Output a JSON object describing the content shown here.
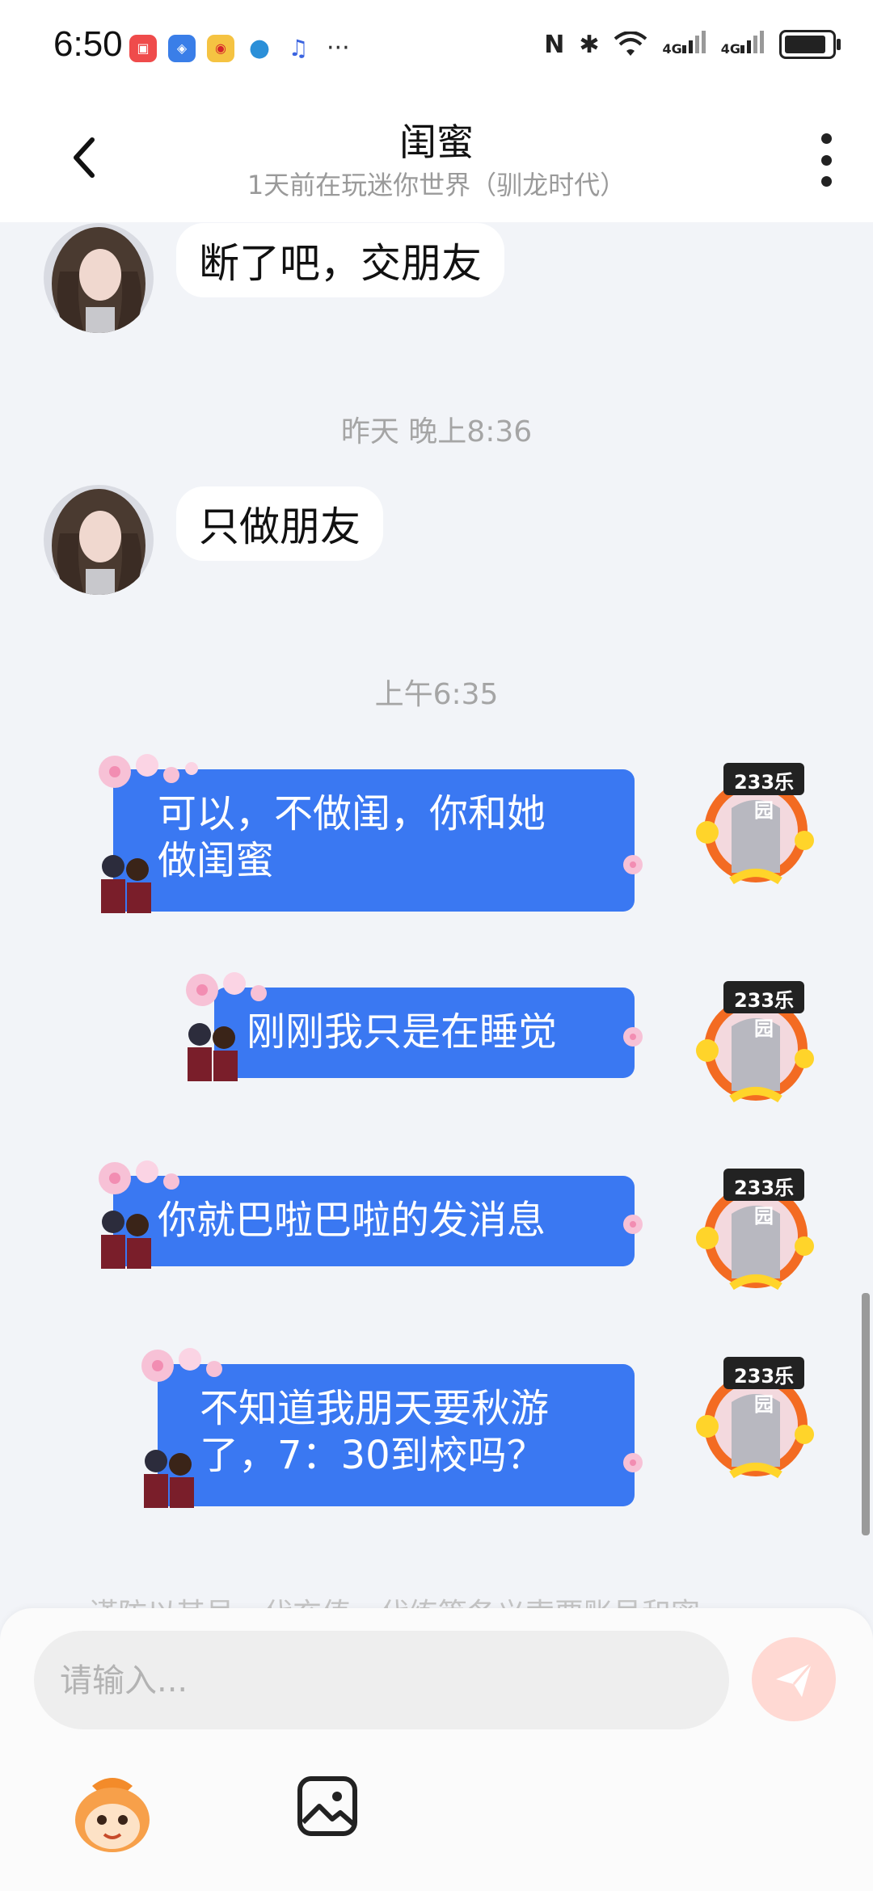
{
  "status_bar": {
    "time": "6:50",
    "more": "···",
    "net1": "4G",
    "net2": "4G"
  },
  "header": {
    "title": "闺蜜",
    "subtitle": "1天前在玩迷你世界（驯龙时代）"
  },
  "messages_in": [
    {
      "text": "断了吧，交朋友"
    },
    {
      "text": "只做朋友"
    }
  ],
  "timestamps": [
    "昨天 晚上8:36",
    "上午6:35"
  ],
  "messages_out": [
    {
      "line1": "可以，不做闺，你和她",
      "line2": "做闺蜜"
    },
    {
      "line1": "刚刚我只是在睡觉"
    },
    {
      "line1": "你就巴啦巴啦的发消息"
    },
    {
      "line1": "不知道我朋天要秋游",
      "line2": "了，7：30到校吗？"
    }
  ],
  "badge_text": "233乐园",
  "notice": "谨防以其号、代充值、代练等各义索要账号和密",
  "input": {
    "placeholder": "请输入..."
  },
  "colors": {
    "bubble_out": "#3a78f2",
    "bubble_in": "#ffffff",
    "background": "#f2f4f8",
    "send_btn": "#ffd9d3"
  },
  "icons": [
    "back-arrow-icon",
    "more-vertical-icon",
    "send-icon",
    "mascot-icon",
    "image-icon"
  ]
}
